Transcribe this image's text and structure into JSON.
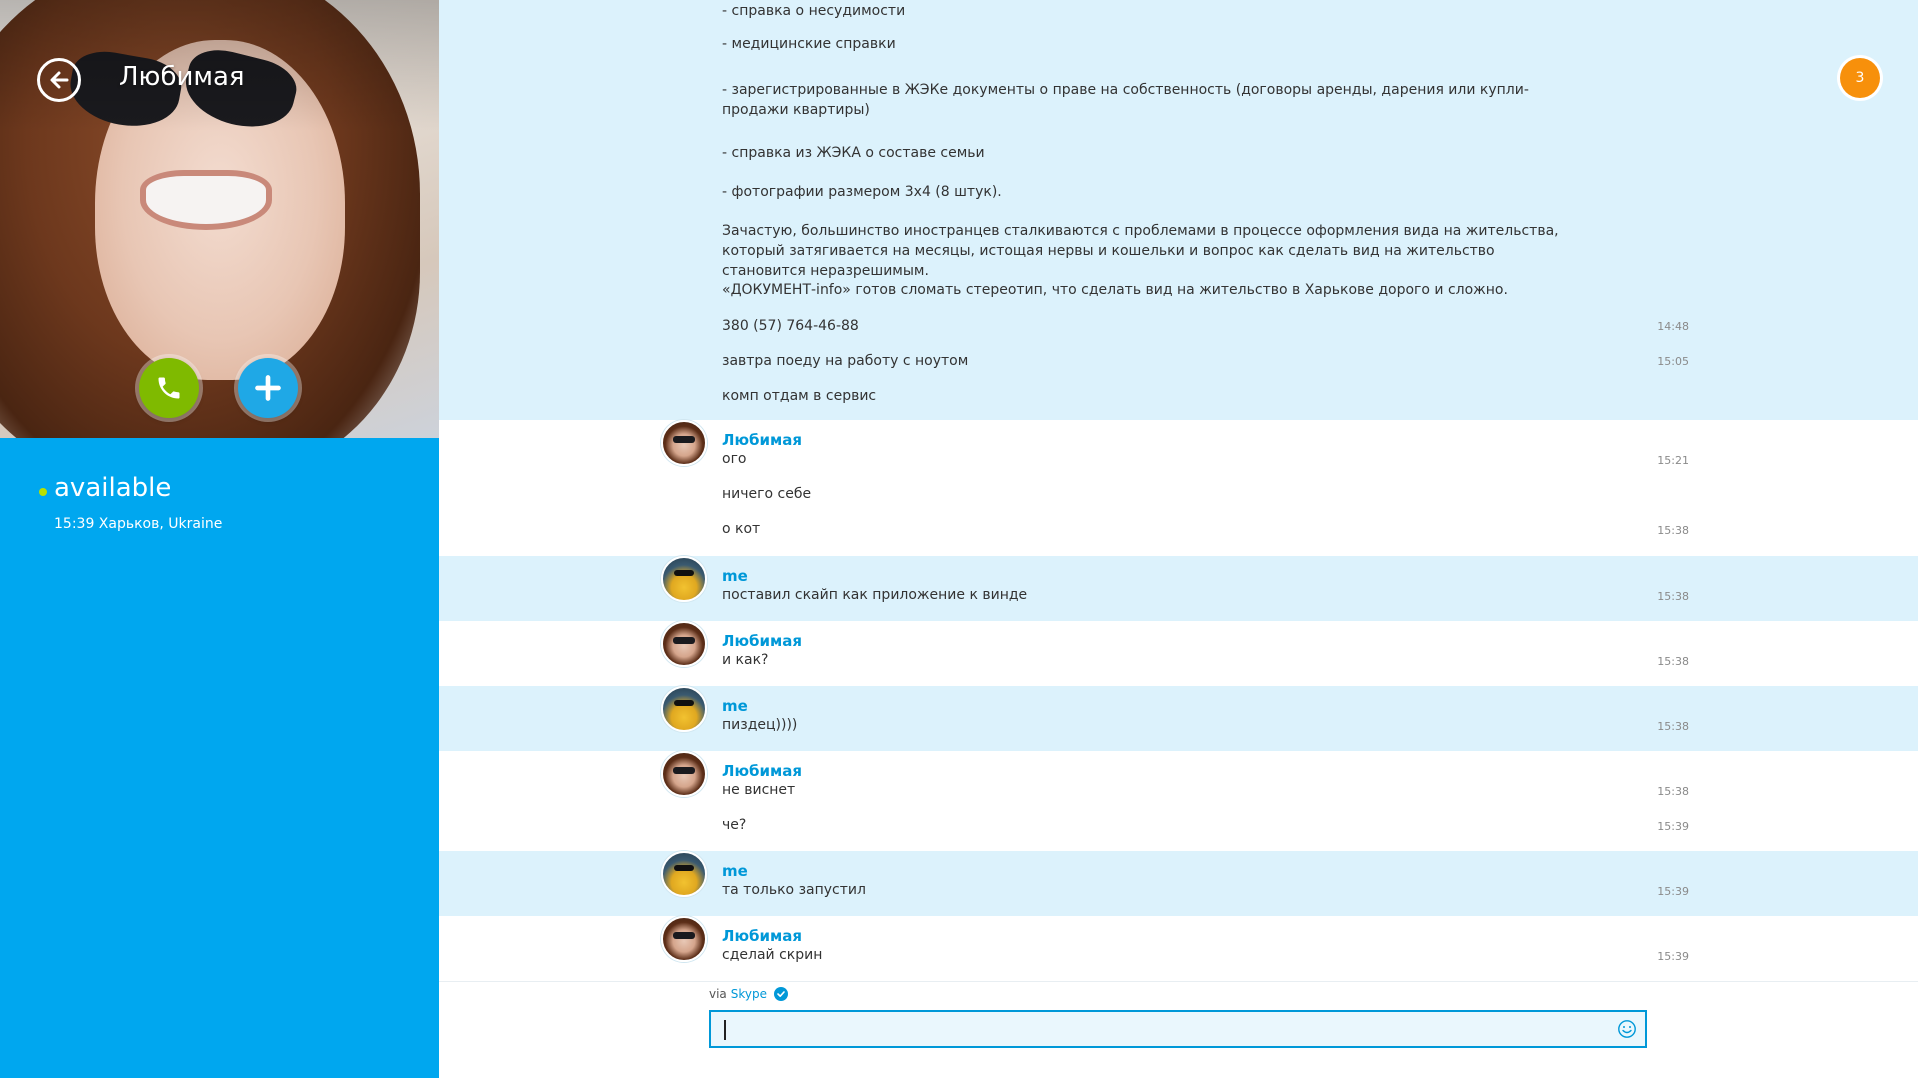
{
  "contact": {
    "name": "Любимая",
    "status": "available",
    "status_detail": "15:39 Харьков, Ukraine"
  },
  "notifications": {
    "unread_count": "3"
  },
  "top_block": {
    "lines": [
      {
        "text": "- справка о несудимости",
        "time": ""
      },
      {
        "text": "- медицинские справки",
        "time": ""
      },
      {
        "text": "- зарегистрированные в ЖЭКе документы о праве на собственность (договоры аренды, дарения или купли-продажи квартиры)",
        "time": ""
      },
      {
        "text": "- справка из ЖЭКА о составе семьи",
        "time": ""
      },
      {
        "text": "- фотографии размером 3х4 (8 штук).",
        "time": ""
      },
      {
        "text": "Зачастую, большинство иностранцев сталкиваются с проблемами в процессе оформления вида на жительства, который затягивается на месяцы, истощая нервы и кошельки и вопрос как сделать вид на жительство становится неразрешимым.",
        "time": ""
      },
      {
        "text": "«ДОКУМЕНТ-info» готов сломать стереотип, что сделать вид на жительство в Харькове дорого и сложно.",
        "time": ""
      },
      {
        "text": "380 (57) 764-46-88",
        "time": "14:48"
      },
      {
        "text": "завтра поеду на работу с ноутом",
        "time": "15:05"
      },
      {
        "text": "комп отдам в сервис",
        "time": ""
      }
    ]
  },
  "messages": [
    {
      "sender": "Любимая",
      "who": "her",
      "lines": [
        {
          "text": "ого",
          "time": "15:21"
        },
        {
          "text": "ничего себе",
          "time": ""
        },
        {
          "text": "о кот",
          "time": "15:38"
        }
      ]
    },
    {
      "sender": "me",
      "who": "me",
      "lines": [
        {
          "text": "поставил скайп как приложение к винде",
          "time": "15:38"
        }
      ]
    },
    {
      "sender": "Любимая",
      "who": "her",
      "lines": [
        {
          "text": "и как?",
          "time": "15:38"
        }
      ]
    },
    {
      "sender": "me",
      "who": "me",
      "lines": [
        {
          "text": "пиздец))))",
          "time": "15:38"
        }
      ]
    },
    {
      "sender": "Любимая",
      "who": "her",
      "lines": [
        {
          "text": "не виснет",
          "time": "15:38"
        },
        {
          "text": "че?",
          "time": "15:39"
        }
      ]
    },
    {
      "sender": "me",
      "who": "me",
      "lines": [
        {
          "text": "та только запустил",
          "time": "15:39"
        }
      ]
    },
    {
      "sender": "Любимая",
      "who": "her",
      "lines": [
        {
          "text": "сделай скрин",
          "time": "15:39"
        }
      ]
    }
  ],
  "composer": {
    "via_prefix": "via",
    "via_service": "Skype",
    "input_value": "",
    "input_placeholder": ""
  },
  "colors": {
    "accent": "#00a7ef",
    "link": "#0098d8",
    "me_row": "#dcf2fc",
    "call": "#7fba00",
    "badge": "#f7900b"
  },
  "icons": {
    "back": "back-arrow-icon",
    "call": "phone-icon",
    "add": "plus-icon",
    "emoji": "smiley-icon",
    "verified": "check-icon"
  }
}
